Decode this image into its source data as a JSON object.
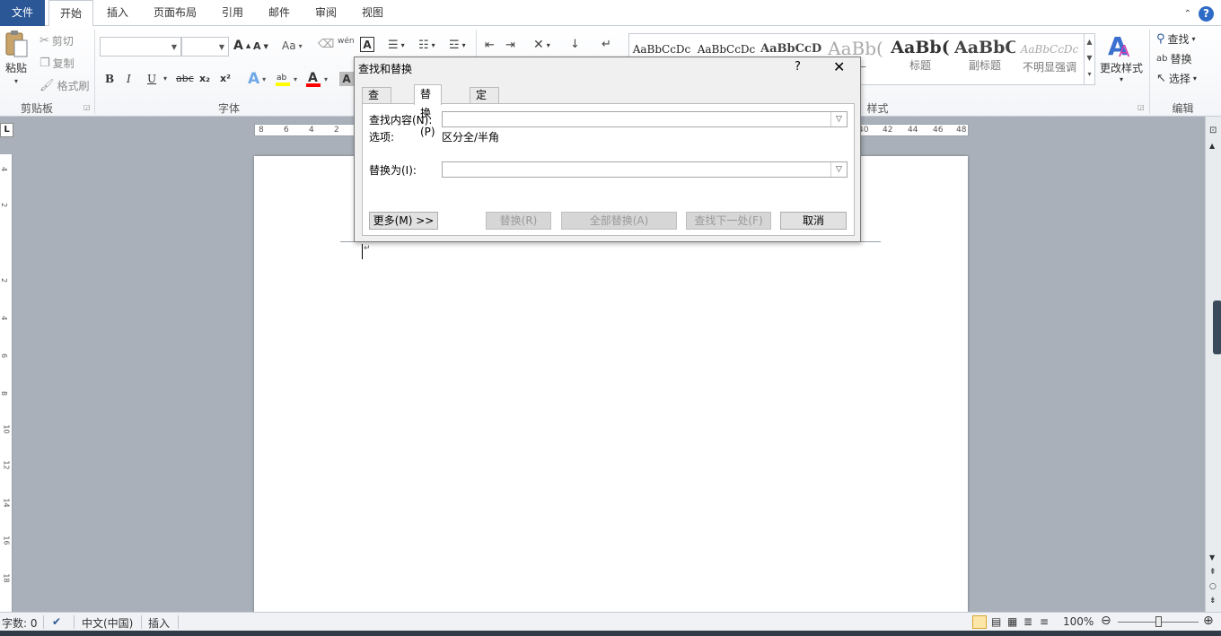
{
  "tabs": [
    {
      "label": "文件"
    },
    {
      "label": "开始"
    },
    {
      "label": "插入"
    },
    {
      "label": "页面布局"
    },
    {
      "label": "引用"
    },
    {
      "label": "邮件"
    },
    {
      "label": "审阅"
    },
    {
      "label": "视图"
    }
  ],
  "clipboard": {
    "paste": "粘贴",
    "cut": "剪切",
    "copy": "复制",
    "format_painter": "格式刷",
    "group": "剪贴板"
  },
  "font": {
    "group": "字体",
    "bold": "B",
    "italic": "I",
    "underline": "U",
    "strike": "abc",
    "subscript": "x₂",
    "superscript": "x²",
    "grow": "A",
    "shrink": "A",
    "case": "Aa",
    "phonetic": "wén",
    "char_border": "A"
  },
  "styles": {
    "group": "样式",
    "items": [
      {
        "sample": "AaBbCcDc",
        "name": ""
      },
      {
        "sample": "AaBbCcDc",
        "name": ""
      },
      {
        "sample": "AaBbCcD",
        "name": ""
      },
      {
        "sample": "AaBb(",
        "name": "式一"
      },
      {
        "sample": "AaBb(",
        "name": "标题"
      },
      {
        "sample": "AaBbC",
        "name": "副标题"
      },
      {
        "sample": "AaBbCcDc",
        "name": "不明显强调"
      }
    ],
    "change_styles": "更改样式"
  },
  "editing": {
    "group": "编辑",
    "find": "查找",
    "replace": "替换",
    "select": "选择"
  },
  "ruler": {
    "left_numbers": [
      "8",
      "6",
      "4",
      "2"
    ],
    "right_numbers": [
      "40",
      "42",
      "44",
      "46",
      "48"
    ],
    "corner": "L"
  },
  "vruler_numbers": [
    "4",
    "2",
    "2",
    "4",
    "6",
    "8",
    "10",
    "12",
    "14",
    "16",
    "18"
  ],
  "dialog": {
    "title": "查找和替换",
    "help": "?",
    "close": "✕",
    "tabs": [
      {
        "label": "查找(D)"
      },
      {
        "label": "替换(P)"
      },
      {
        "label": "定位(G)"
      }
    ],
    "find_label": "查找内容(N):",
    "options_label": "选项:",
    "options_value": "区分全/半角",
    "replace_label": "替换为(I):",
    "find_value": "",
    "replace_value": "",
    "buttons": {
      "more": "更多(M) >>",
      "replace": "替换(R)",
      "replace_all": "全部替换(A)",
      "find_next": "查找下一处(F)",
      "cancel": "取消"
    }
  },
  "status": {
    "word_count": "字数: 0",
    "language": "中文(中国)",
    "mode": "插入",
    "zoom": "100%"
  },
  "colors": {
    "file_tab": "#2b5797",
    "highlight": "#ffff00",
    "font_color": "#ff0000",
    "scroll_thumb": "#3a4a5a"
  }
}
